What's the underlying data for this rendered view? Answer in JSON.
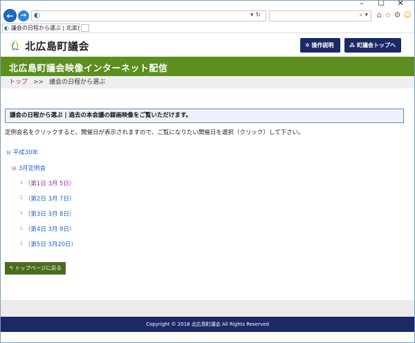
{
  "browser": {
    "window_controls": [
      "–",
      "☐",
      "✕"
    ],
    "tab_title": "議会の日程から選ぶ | 北広島...",
    "tab_close": "×"
  },
  "header": {
    "site_name": "北広島町議会",
    "help_button": "操作説明",
    "top_button": "町議会トップへ"
  },
  "banner": {
    "title": "北広島町議会映像インターネット配信"
  },
  "breadcrumb": {
    "home": "トップ",
    "separator": ">>",
    "current": "議会の日程から選ぶ"
  },
  "notice": "議会の日程から選ぶ | 過去の本会議の録画映像をご覧いただけます。",
  "description": "定例会名をクリックすると、開催日が表示されますので、ご覧になりたい開催日を選択（クリック）して下さい。",
  "tree": {
    "year": "平成30年",
    "session": "3月定例会",
    "days": [
      "（第1日 3月 5日）",
      "（第2日 3月 7日）",
      "（第3日 3月 8日）",
      "（第4日 3月 9日）",
      "（第5日 3月20日）"
    ]
  },
  "back_button": "トップページに戻る",
  "footer": "Copyright © 2018 北広島町議会 All Rights Reserved",
  "colors": {
    "navy": "#1b2a66",
    "green": "#5c8f1f",
    "dark_green": "#4a6c1c",
    "visited_link": "#8e2d99",
    "link": "#1b60c9"
  }
}
